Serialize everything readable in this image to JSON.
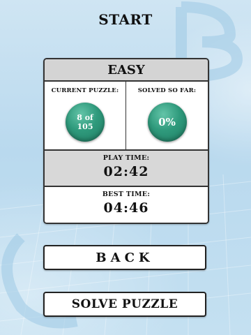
{
  "header": {
    "title": "START"
  },
  "panel": {
    "difficulty": "EASY",
    "current_puzzle": {
      "label": "CURRENT PUZZLE:",
      "value_line1": "8 of",
      "value_line2": "105"
    },
    "solved_so_far": {
      "label": "SOLVED SO FAR:",
      "value": "0%"
    },
    "play_time": {
      "label": "PLAY TIME:",
      "value": "02:42"
    },
    "best_time": {
      "label": "BEST TIME:",
      "value": "04:46"
    }
  },
  "buttons": {
    "back_label": "BACK",
    "solve_label": "SOLVE PUZZLE"
  },
  "colors": {
    "accent": "#2f9a7c",
    "background": "#c4e0f1",
    "header_fill": "#d4d4d4"
  }
}
